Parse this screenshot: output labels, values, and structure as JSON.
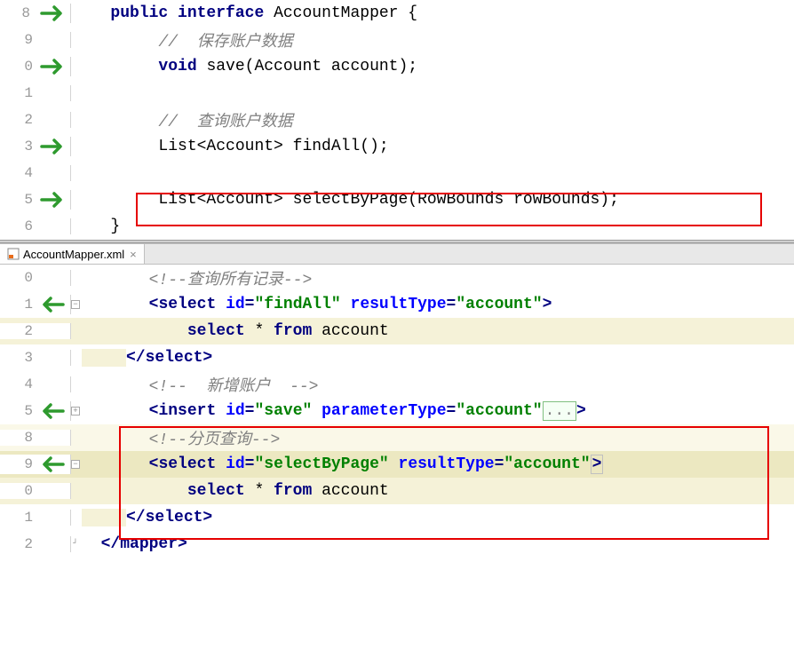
{
  "top_panel": {
    "lines": {
      "l8": {
        "num": "8",
        "kw_public": "public",
        "kw_interface": "interface",
        "type": "AccountMapper",
        "brace": " {"
      },
      "l9": {
        "num": "9",
        "comment": "//  保存账户数据"
      },
      "l10": {
        "num": "0",
        "kw_void": "void",
        "method": " save(Account account);"
      },
      "l11": {
        "num": "1"
      },
      "l12": {
        "num": "2",
        "comment": "//  查询账户数据"
      },
      "l13": {
        "num": "3",
        "text": "List<Account> findAll();"
      },
      "l14": {
        "num": "4"
      },
      "l15": {
        "num": "5",
        "text": "List<Account> selectByPage(RowBounds rowBounds);"
      },
      "l16": {
        "num": "6",
        "brace": "}"
      }
    }
  },
  "tab": {
    "label": "AccountMapper.xml"
  },
  "bottom_panel": {
    "lines": {
      "l20": {
        "num": "0",
        "c_open": "<!--",
        "c_text": "查询所有记录",
        "c_close": "-->"
      },
      "l21": {
        "num": "1",
        "tag": "select",
        "attr1": "id",
        "val1": "\"findAll\"",
        "attr2": "resultType",
        "val2": "\"account\""
      },
      "l22": {
        "num": "2",
        "kw_select": "select",
        "star": " * ",
        "kw_from": "from",
        "tbl": " account"
      },
      "l23": {
        "num": "3",
        "tag": "select"
      },
      "l24": {
        "num": "4",
        "c_open": "<!--",
        "c_text": "  新增账户  ",
        "c_close": "-->"
      },
      "l25": {
        "num": "5",
        "tag": "insert",
        "attr1": "id",
        "val1": "\"save\"",
        "attr2": "parameterType",
        "val2": "\"account\"",
        "dots": "..."
      },
      "l28": {
        "num": "8",
        "c_open": "<!--",
        "c_text": "分页查询",
        "c_close": "-->"
      },
      "l29": {
        "num": "9",
        "tag": "select",
        "attr1": "id",
        "val1": "\"selectByPage\"",
        "attr2": "resultType",
        "val2": "\"account\""
      },
      "l30": {
        "num": "0",
        "kw_select": "select",
        "star": " * ",
        "kw_from": "from",
        "tbl": " account"
      },
      "l31": {
        "num": "1",
        "tag": "select"
      },
      "l32": {
        "num": "2",
        "tag": "mapper"
      }
    }
  }
}
